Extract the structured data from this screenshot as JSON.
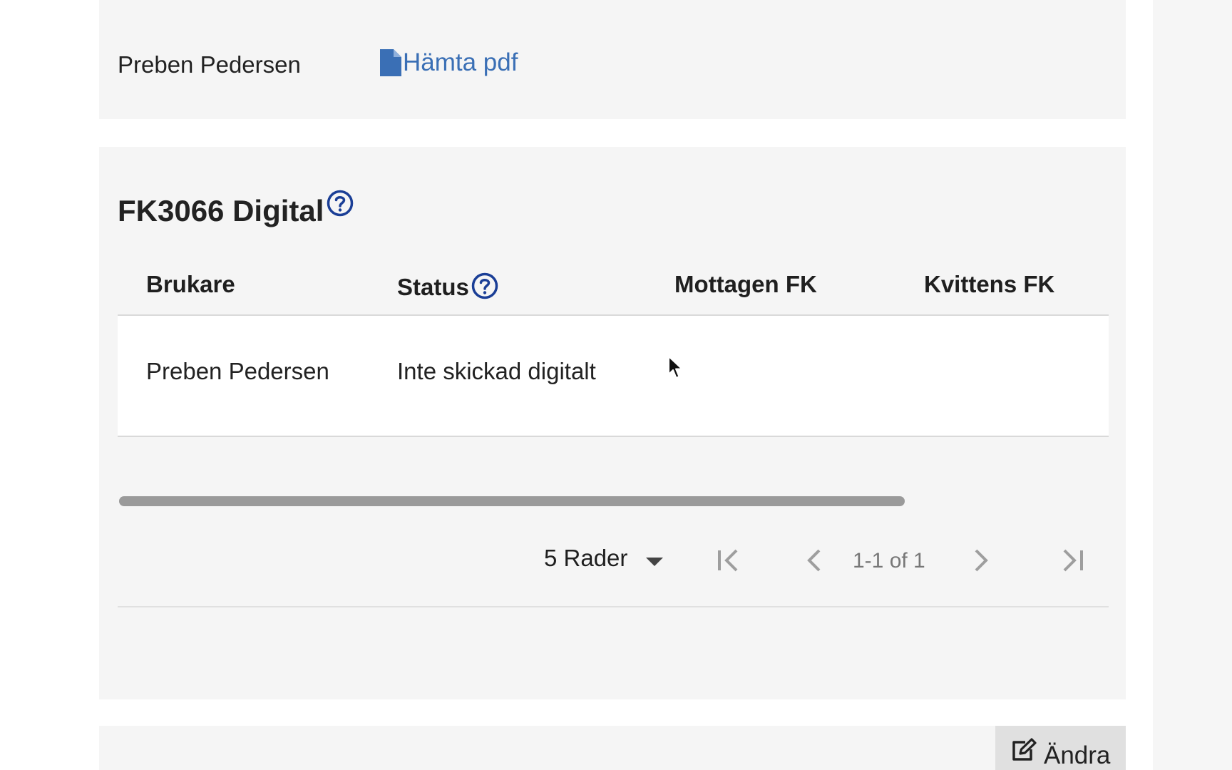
{
  "top_card": {
    "user_name": "Preben Pedersen",
    "pdf_link_label": "Hämta pdf",
    "pdf_icon": "file-icon"
  },
  "section": {
    "title": "FK3066 Digital",
    "help_icon": "question-circle-icon"
  },
  "table": {
    "columns": [
      "Brukare",
      "Status",
      "Mottagen FK",
      "Kvittens FK"
    ],
    "rows": [
      {
        "brukare": "Preben Pedersen",
        "status": "Inte skickad digitalt",
        "mottagen_fk": "",
        "kvittens_fk": ""
      }
    ]
  },
  "pagination": {
    "rows_per_page_label": "5 Rader",
    "page_info": "1-1 of 1"
  },
  "bottom_card": {
    "edit_label": "Ändra",
    "edit_icon": "edit-icon"
  },
  "colors": {
    "link": "#3a6fb5",
    "help_icon": "#1a3e96",
    "card_background": "#f5f5f5"
  }
}
